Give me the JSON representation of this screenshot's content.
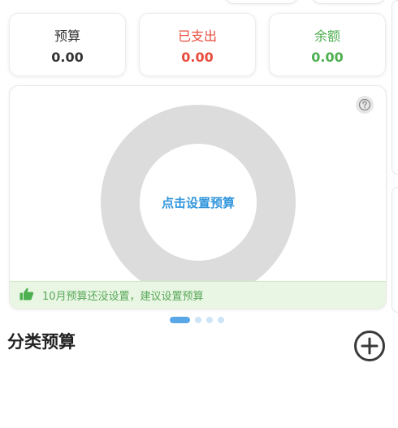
{
  "summary": {
    "budget": {
      "label": "预算",
      "value": "0.00",
      "color": "#333333"
    },
    "spent": {
      "label": "已支出",
      "value": "0.00",
      "color": "#e84c3d"
    },
    "remaining": {
      "label": "余额",
      "value": "0.00",
      "color": "#4caf50"
    }
  },
  "chart": {
    "center_link": "点击设置预算",
    "help_icon": "question-circle-icon"
  },
  "tip": {
    "icon": "thumbs-up-icon",
    "text": "10月预算还没设置，建议设置预算"
  },
  "pager": {
    "pages": 4,
    "active_index": 0
  },
  "category_section": {
    "title": "分类预算",
    "add_icon": "plus-circle-icon"
  },
  "colors": {
    "accent": "#3296dc",
    "ring": "#dcdcdc",
    "tip_bg": "#e9f6e3",
    "tip_text": "#58a85a"
  }
}
